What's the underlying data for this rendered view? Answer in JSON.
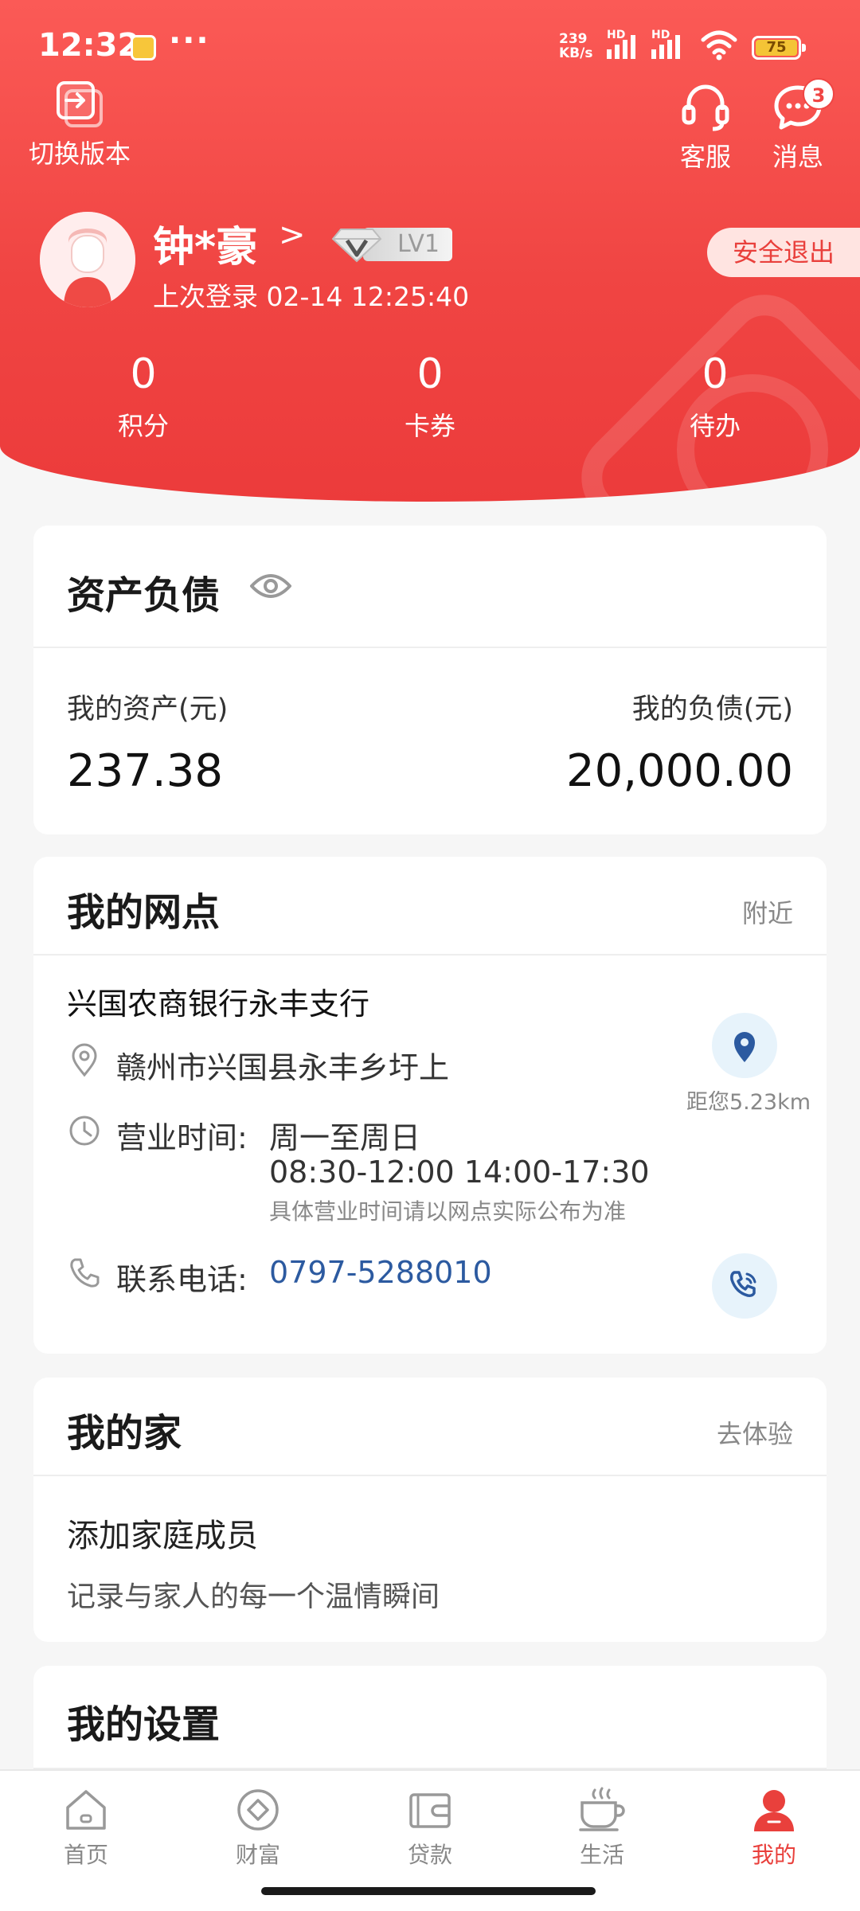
{
  "status_bar": {
    "time": "12:32",
    "dots": "···",
    "net_speed_value": "239",
    "net_speed_unit": "KB/s",
    "hd_label": "HD",
    "battery": "75"
  },
  "header": {
    "switch_version_label": "切换版本",
    "service_label": "客服",
    "messages_label": "消息",
    "message_count": "3",
    "user_name": "钟*豪",
    "chevron": ">",
    "level": "LV1",
    "last_login": "上次登录 02-14 12:25:40",
    "logout_label": "安全退出",
    "stats": [
      {
        "value": "0",
        "label": "积分"
      },
      {
        "value": "0",
        "label": "卡券"
      },
      {
        "value": "0",
        "label": "待办"
      }
    ]
  },
  "assets": {
    "title": "资产负债",
    "assets_label": "我的资产(元)",
    "assets_value": "237.38",
    "liabilities_label": "我的负债(元)",
    "liabilities_value": "20,000.00"
  },
  "branch": {
    "title": "我的网点",
    "nearby_label": "附近",
    "name": "兴国农商银行永丰支行",
    "address": "赣州市兴国县永丰乡圩上",
    "distance": "距您5.23km",
    "hours_label": "营业时间:",
    "hours_days": "周一至周日",
    "hours_times": "08:30-12:00 14:00-17:30",
    "hours_note": "具体营业时间请以网点实际公布为准",
    "phone_label": "联系电话:",
    "phone": "0797-5288010"
  },
  "family": {
    "title": "我的家",
    "try_label": "去体验",
    "add_title": "添加家庭成员",
    "add_desc": "记录与家人的每一个温情瞬间"
  },
  "settings": {
    "title": "我的设置"
  },
  "bottom_nav": {
    "items": [
      {
        "label": "首页"
      },
      {
        "label": "财富"
      },
      {
        "label": "贷款"
      },
      {
        "label": "生活"
      },
      {
        "label": "我的"
      }
    ]
  },
  "colors": {
    "brand_red": "#f04543",
    "link_blue": "#2c5aa0",
    "icon_blue": "#2c5aa0"
  }
}
